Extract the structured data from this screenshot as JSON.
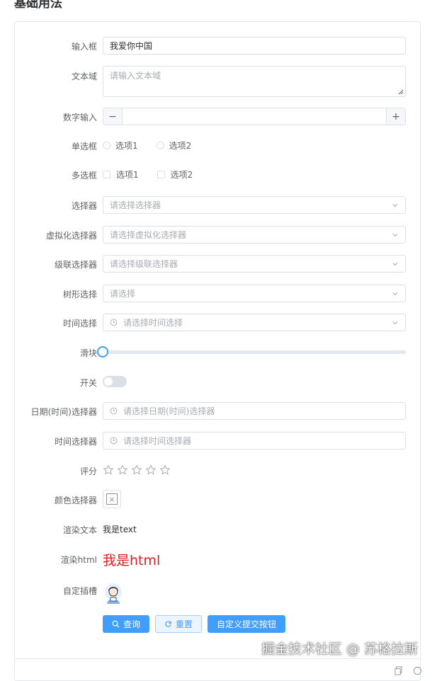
{
  "page_title": "基础用法",
  "form": {
    "input": {
      "label": "输入框",
      "value": "我爱你中国"
    },
    "textarea": {
      "label": "文本域",
      "placeholder": "请输入文本域"
    },
    "number": {
      "label": "数字输入",
      "minus": "−",
      "plus": "+"
    },
    "radio": {
      "label": "单选框",
      "options": [
        "选项1",
        "选项2"
      ]
    },
    "checkbox": {
      "label": "多选框",
      "options": [
        "选项1",
        "选项2"
      ]
    },
    "select": {
      "label": "选择器",
      "placeholder": "请选择选择器"
    },
    "vselect": {
      "label": "虚拟化选择器",
      "placeholder": "请选择虚拟化选择器"
    },
    "cascader": {
      "label": "级联选择器",
      "placeholder": "请选择级联选择器"
    },
    "tree": {
      "label": "树形选择",
      "placeholder": "请选择"
    },
    "time_select": {
      "label": "时间选择",
      "placeholder": "请选择时间选择"
    },
    "slider": {
      "label": "滑块",
      "value": 0
    },
    "switch": {
      "label": "开关",
      "on": false
    },
    "datetime": {
      "label": "日期(时间)选择器",
      "placeholder": "请选择日期(时间)选择器"
    },
    "time_picker": {
      "label": "时间选择器",
      "placeholder": "请选择时间选择器"
    },
    "rate": {
      "label": "评分",
      "value": 0,
      "max": 5
    },
    "color": {
      "label": "颜色选择器",
      "empty_glyph": "×"
    },
    "render_text": {
      "label": "渲染文本",
      "value": "我是text"
    },
    "render_html": {
      "label": "渲染html",
      "value": "我是html"
    },
    "slot": {
      "label": "自定插槽"
    }
  },
  "buttons": {
    "query": "查询",
    "reset": "重置",
    "custom_submit": "自定义提交按钮"
  },
  "watermark": "掘金技术社区 @ 苏格拉斯",
  "colors": {
    "primary": "#409eff",
    "border": "#dcdfe6",
    "placeholder": "#a8abb2",
    "html_red": "#e01b1b"
  }
}
